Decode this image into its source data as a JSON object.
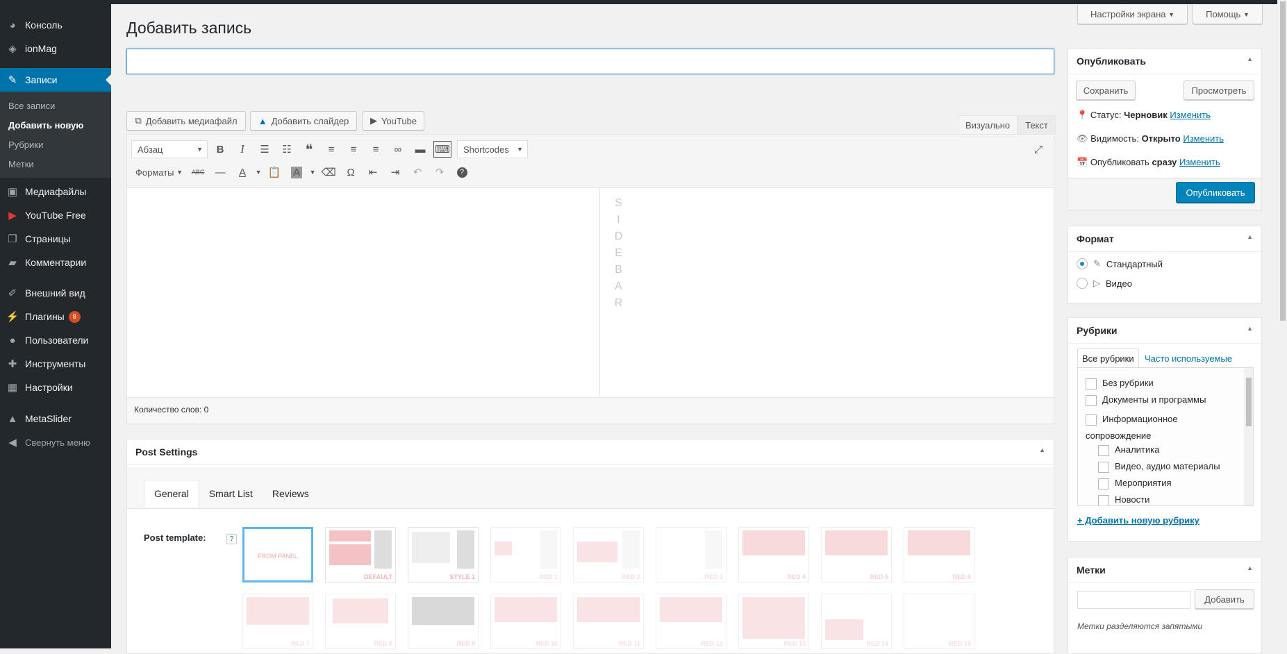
{
  "sidebar": {
    "items": [
      {
        "label": "Консоль",
        "icon": "dashboard-icon"
      },
      {
        "label": "ionMag",
        "icon": "ionmag-icon"
      },
      {
        "label": "Записи",
        "icon": "pin-icon"
      },
      {
        "label": "Медиафайлы",
        "icon": "media-icon"
      },
      {
        "label": "YouTube Free",
        "icon": "youtube-icon"
      },
      {
        "label": "Страницы",
        "icon": "pages-icon"
      },
      {
        "label": "Комментарии",
        "icon": "comments-icon"
      },
      {
        "label": "Внешний вид",
        "icon": "appearance-icon"
      },
      {
        "label": "Плагины",
        "icon": "plugins-icon",
        "badge": "8"
      },
      {
        "label": "Пользователи",
        "icon": "users-icon"
      },
      {
        "label": "Инструменты",
        "icon": "tools-icon"
      },
      {
        "label": "Настройки",
        "icon": "settings-icon"
      },
      {
        "label": "MetaSlider",
        "icon": "metaslider-icon"
      },
      {
        "label": "Свернуть меню",
        "icon": "collapse-icon"
      }
    ],
    "submenu": [
      "Все записи",
      "Добавить новую",
      "Рубрики",
      "Метки"
    ]
  },
  "header": {
    "title": "Добавить запись",
    "screen_options": "Настройки экрана",
    "help": "Помощь"
  },
  "title_input": {
    "value": "",
    "placeholder": ""
  },
  "media_buttons": {
    "add_media": "Добавить медиафайл",
    "add_slider": "Добавить слайдер",
    "youtube": "YouTube"
  },
  "editor_tabs": {
    "visual": "Визуально",
    "text": "Текст"
  },
  "toolbar": {
    "format_select": "Абзац",
    "shortcodes": "Shortcodes",
    "formats": "Форматы"
  },
  "editor": {
    "sidebar_letters": [
      "S",
      "I",
      "D",
      "E",
      "B",
      "A",
      "R"
    ],
    "word_count": "Количество слов: 0"
  },
  "publish": {
    "title": "Опубликовать",
    "save": "Сохранить",
    "preview": "Просмотреть",
    "status_label": "Статус:",
    "status_value": "Черновик",
    "visibility_label": "Видимость:",
    "visibility_value": "Открыто",
    "publish_label": "Опубликовать",
    "publish_value": "сразу",
    "edit": "Изменить",
    "publish_button": "Опубликовать"
  },
  "format_box": {
    "title": "Формат",
    "options": [
      "Стандартный",
      "Видео"
    ]
  },
  "categories": {
    "title": "Рубрики",
    "tab_all": "Все рубрики",
    "tab_popular": "Часто используемые",
    "items": [
      "Без рубрики",
      "Документы и программы",
      "Информационное сопровождение"
    ],
    "children": [
      "Аналитика",
      "Видео, аудио материалы",
      "Мероприятия",
      "Новости"
    ],
    "add_new": "+ Добавить новую рубрику"
  },
  "tags": {
    "title": "Метки",
    "add": "Добавить",
    "hint": "Метки разделяются запятыми"
  },
  "post_settings": {
    "title": "Post Settings",
    "tabs": [
      "General",
      "Smart List",
      "Reviews"
    ],
    "template_label": "Post template:",
    "help": "?",
    "templates": [
      "FROM PANEL",
      "DEFAULT",
      "STYLE 1",
      "RED 1",
      "RED 2",
      "RED 3",
      "RED 4",
      "RED 5",
      "RED 6",
      "RED 7",
      "RED 8",
      "RED 9",
      "RED 10",
      "RED 11",
      "RED 12",
      "RED 13",
      "RED 14",
      "RED 15"
    ]
  }
}
